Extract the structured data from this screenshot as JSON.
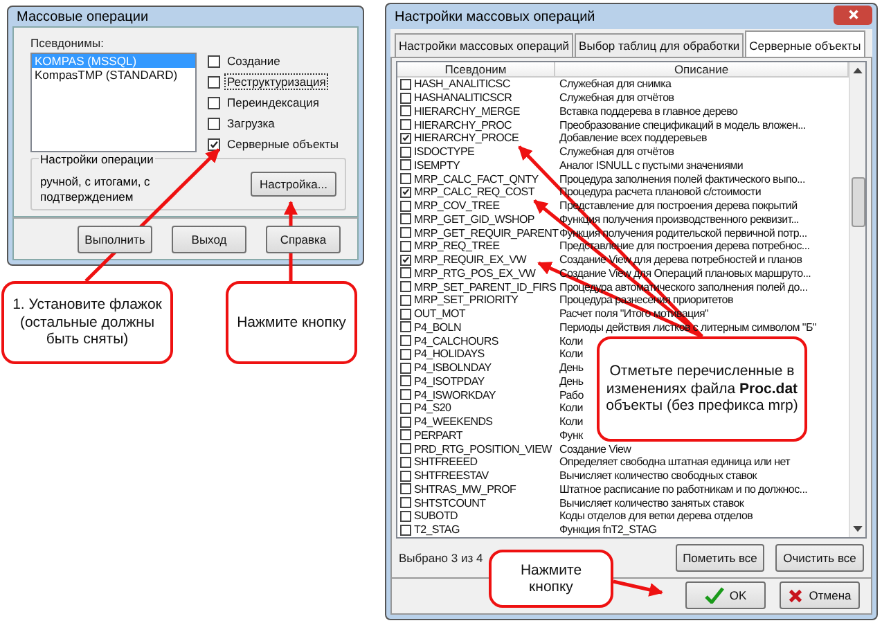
{
  "left_dialog": {
    "title": "Массовые операции",
    "aliases_label": "Псевдонимы:",
    "aliases": [
      {
        "label": "KOMPAS (MSSQL)",
        "selected": true
      },
      {
        "label": "KompasTMP (STANDARD)",
        "selected": false
      }
    ],
    "operations": [
      {
        "label": "Создание",
        "checked": false,
        "focused": false
      },
      {
        "label": "Реструктуризация",
        "checked": false,
        "focused": true
      },
      {
        "label": "Переиндексация",
        "checked": false,
        "focused": false
      },
      {
        "label": "Загрузка",
        "checked": false,
        "focused": false
      },
      {
        "label": "Серверные объекты",
        "checked": true,
        "focused": false
      }
    ],
    "settings_group": {
      "title": "Настройки операции",
      "description": "ручной, с итогами, с подтверждением",
      "button": "Настройка..."
    },
    "buttons": [
      "Выполнить",
      "Выход",
      "Справка"
    ]
  },
  "right_dialog": {
    "title": "Настройки массовых операций",
    "tabs": [
      {
        "label": "Настройки массовых операций",
        "selected": false
      },
      {
        "label": "Выбор таблиц для обработки",
        "selected": false
      },
      {
        "label": "Серверные объекты",
        "selected": true
      }
    ],
    "columns": [
      "Псевдоним",
      "Описание"
    ],
    "rows": [
      {
        "name": "HASH_ANALITICSC",
        "description": "Служебная для снимка",
        "checked": false
      },
      {
        "name": "HASHANALITICSCR",
        "description": "Служебная для отчётов",
        "checked": false
      },
      {
        "name": "HIERARCHY_MERGE",
        "description": "Вставка поддерева в главное дерево",
        "checked": false
      },
      {
        "name": "HIERARCHY_PROC",
        "description": "Преобразование спецификаций в модель вложен...",
        "checked": false
      },
      {
        "name": "HIERARCHY_PROCE",
        "description": "Добавление всех поддеревьев",
        "checked": true
      },
      {
        "name": "ISDOCTYPE",
        "description": "Служебная для отчётов",
        "checked": false
      },
      {
        "name": "ISEMPTY",
        "description": "Аналог ISNULL с пустыми значениями",
        "checked": false
      },
      {
        "name": "MRP_CALC_FACT_QNTY",
        "description": "Процедура заполнения полей фактического выпо...",
        "checked": false
      },
      {
        "name": "MRP_CALC_REQ_COST",
        "description": "Процедура расчета плановой с/стоимости",
        "checked": true
      },
      {
        "name": "MRP_COV_TREE",
        "description": "Представление для построения дерева покрытий",
        "checked": false
      },
      {
        "name": "MRP_GET_GID_WSHOP",
        "description": "Функция получения производственного реквизит...",
        "checked": false
      },
      {
        "name": "MRP_GET_REQUIR_PARENT",
        "description": "Функция получения родительской первичной потр...",
        "checked": false
      },
      {
        "name": "MRP_REQ_TREE",
        "description": "Представление для построения дерева потребнос...",
        "checked": false
      },
      {
        "name": "MRP_REQUIR_EX_VW",
        "description": "Создание View для дерева потребностей и планов",
        "checked": true
      },
      {
        "name": "MRP_RTG_POS_EX_VW",
        "description": "Создание View для Операций плановых маршруто...",
        "checked": false
      },
      {
        "name": "MRP_SET_PARENT_ID_FIRS",
        "description": "Процедура автоматического заполнения полей до...",
        "checked": false
      },
      {
        "name": "MRP_SET_PRIORITY",
        "description": "Процедура разнесения приоритетов",
        "checked": false
      },
      {
        "name": "OUT_MOT",
        "description": "Расчет поля \"Итого мотивация\"",
        "checked": false
      },
      {
        "name": "P4_BOLN",
        "description": "Периоды действия листков с литерным символом \"Б\"",
        "checked": false
      },
      {
        "name": "P4_CALCHOURS",
        "description": "Коли",
        "checked": false
      },
      {
        "name": "P4_HOLIDAYS",
        "description": "Коли",
        "checked": false
      },
      {
        "name": "P4_ISBOLNDAY",
        "description": "День",
        "checked": false
      },
      {
        "name": "P4_ISOTPDAY",
        "description": "День",
        "checked": false
      },
      {
        "name": "P4_ISWORKDAY",
        "description": "Рабо",
        "checked": false
      },
      {
        "name": "P4_S20",
        "description": "Коли",
        "checked": false
      },
      {
        "name": "P4_WEEKENDS",
        "description": "Коли",
        "checked": false
      },
      {
        "name": "PERPART",
        "description": "Функ",
        "checked": false
      },
      {
        "name": "PRD_RTG_POSITION_VIEW",
        "description": "Создание View",
        "checked": false
      },
      {
        "name": "SHTFREEED",
        "description": "Определяет свободна штатная единица или нет",
        "checked": false
      },
      {
        "name": "SHTFREESTAV",
        "description": "Вычисляет количество свободных ставок",
        "checked": false
      },
      {
        "name": "SHTRAS_MW_PROF",
        "description": "Штатное расписание по работникам и по должнос...",
        "checked": false
      },
      {
        "name": "SHTSTCOUNT",
        "description": "Вычисляет количество занятых ставок",
        "checked": false
      },
      {
        "name": "SUBOTD",
        "description": "Коды отделов для ветки дерева отделов",
        "checked": false
      },
      {
        "name": "T2_STAG",
        "description": "Функция fnT2_STAG",
        "checked": false
      }
    ],
    "selection_count": "Выбрано 3 из 4",
    "list_buttons": [
      "Пометить все",
      "Очистить все"
    ],
    "ok_button": "OK",
    "cancel_button": "Отмена"
  },
  "callouts": [
    {
      "text": "1. Установите флажок (остальные должны быть сняты)"
    },
    {
      "text": "Нажмите кнопку"
    },
    {
      "text": "Отметьте перечисленные в изменениях файла **Proc.dat** объекты (без префикса mrp)"
    },
    {
      "text": "Нажмите кнопку"
    }
  ]
}
